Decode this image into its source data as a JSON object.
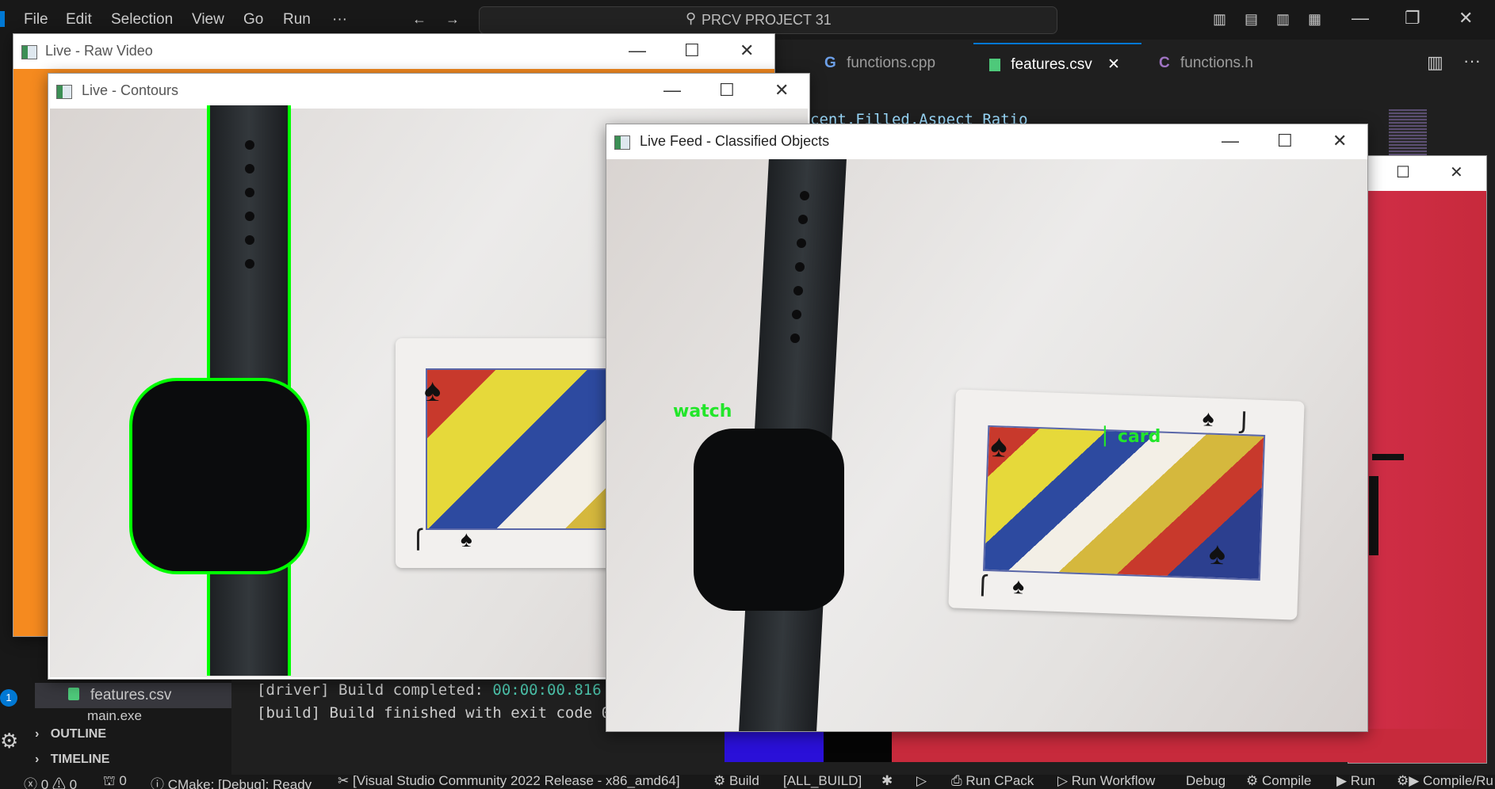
{
  "vscode": {
    "menu": [
      "File",
      "Edit",
      "Selection",
      "View",
      "Go",
      "Run",
      "···"
    ],
    "search_title": "PRCV PROJECT 31",
    "tabs": [
      {
        "label": "functions.cpp",
        "icon": "cpp-file-icon"
      },
      {
        "label": "features.csv",
        "icon": "csv-file-icon",
        "active": true
      },
      {
        "label": "functions.h",
        "icon": "c-header-icon"
      }
    ],
    "code_line": "cent,Filled,Aspect Ratio",
    "sidebar": {
      "file": "features.csv",
      "partial_file": "main.exe",
      "outline": "OUTLINE",
      "timeline": "TIMELINE"
    },
    "badge_count": "1",
    "terminal": {
      "line1_prefix": "[driver] Build completed: ",
      "line1_time": "00:00:00.816",
      "line2": "[build] Build finished with exit code 0"
    },
    "status": {
      "errors": "0",
      "warnings": "0",
      "ports": "0",
      "cmake": "CMake: [Debug]: Ready",
      "kit": "[Visual Studio Community 2022 Release - x86_amd64]",
      "build": "Build",
      "target": "[ALL_BUILD]",
      "cpack": "Run CPack",
      "workflow": "Run Workflow",
      "debug": "Debug",
      "compile": "Compile",
      "run": "Run",
      "compile_run": "Compile/Ru"
    }
  },
  "windows": {
    "raw": {
      "title": "Live - Raw Video"
    },
    "contours": {
      "title": "Live - Contours"
    },
    "classified": {
      "title": "Live Feed - Classified Objects"
    },
    "minimize": "—",
    "maximize": "☐",
    "close": "✕"
  },
  "labels": {
    "watch": "watch",
    "card": "card",
    "card_rank": "J"
  },
  "colors": {
    "accent": "#0078d4",
    "contour": "#00ff00",
    "label": "#22e62a",
    "raw_bg": "#f58a1f",
    "red_win": "#c8283a"
  }
}
